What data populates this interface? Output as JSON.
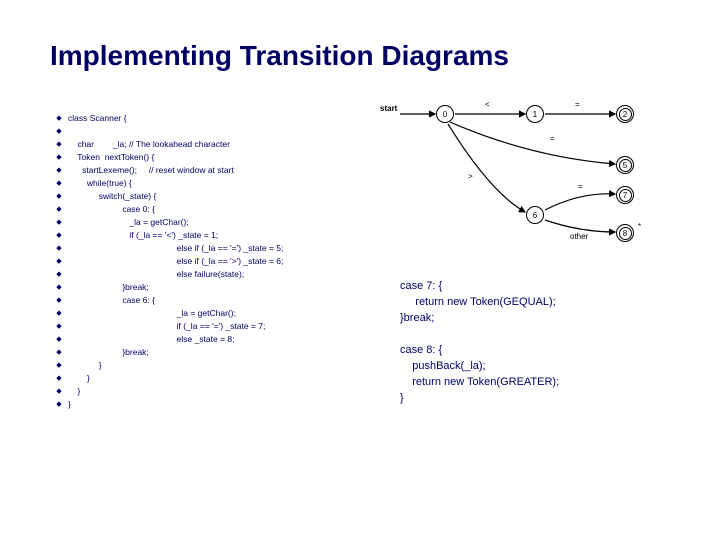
{
  "title": "Implementing Transition Diagrams",
  "code": [
    "class Scanner {",
    "",
    "    char        _la; // The lookahead character",
    "    Token  nextToken() {",
    "      startLexeme();     // reset window at start",
    "        while(true) {",
    "             switch(_state) {",
    "                       case 0: {",
    "                          _la = getChar();",
    "                          if (_la == '<') _state = 1;",
    "                                              else if (_la == '=') _state = 5;",
    "                                              else if (_la == '>') _state = 6;",
    "                                              else failure(state);",
    "                       }break;",
    "                       case 6: {",
    "                                              _la = getChar();",
    "                                              if (_la == '=') _state = 7;",
    "                                              else _state = 8;",
    "                       }break;",
    "             }",
    "        }",
    "    }",
    "}"
  ],
  "rightcode": "case 7: {\n     return new Token(GEQUAL);\n}break;\n\ncase 8: {\n    pushBack(_la);\n    return new Token(GREATER);\n}",
  "diagram": {
    "start_label": "start",
    "nodes": [
      {
        "id": "0",
        "final": false
      },
      {
        "id": "1",
        "final": false
      },
      {
        "id": "2",
        "final": true
      },
      {
        "id": "5",
        "final": true
      },
      {
        "id": "6",
        "final": false
      },
      {
        "id": "7",
        "final": true
      },
      {
        "id": "8",
        "final": true
      }
    ],
    "labels": {
      "lt": "<",
      "eq": "=",
      "gt": ">",
      "other": "other"
    }
  }
}
